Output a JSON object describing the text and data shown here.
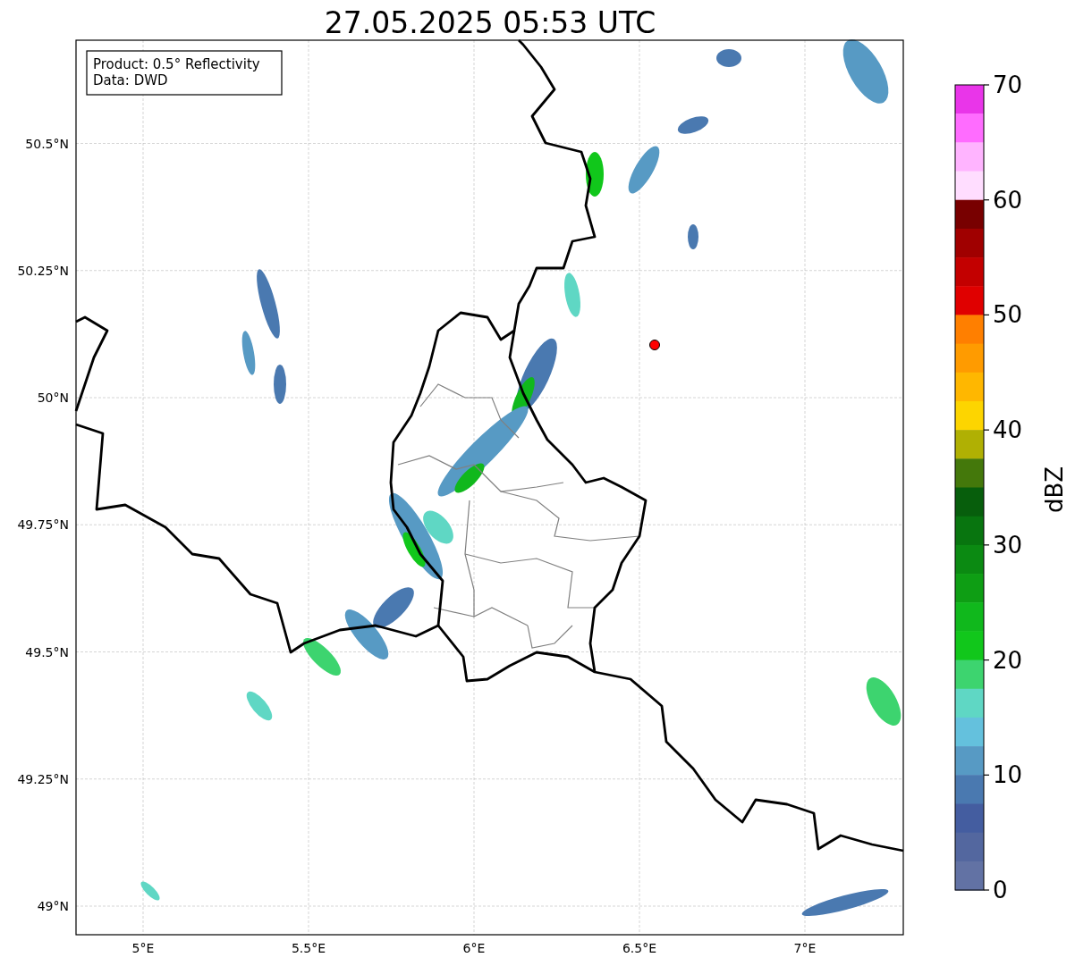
{
  "title": "27.05.2025 05:53 UTC",
  "info_box": [
    "Product: 0.5° Reflectivity",
    "Data: DWD"
  ],
  "map": {
    "lat_labels": [
      "50.5°N",
      "50.25°N",
      "50°N",
      "49.75°N",
      "49.5°N",
      "49.25°N",
      "49°N"
    ],
    "lon_labels": [
      "5°E",
      "5.5°E",
      "6°E",
      "6.5°E",
      "7°E"
    ]
  },
  "colorbar": {
    "label": "dBZ",
    "ticks": [
      "70",
      "60",
      "50",
      "40",
      "30",
      "20",
      "10",
      "0"
    ],
    "bins": [
      {
        "color": "#e935e9"
      },
      {
        "color": "#ff6cff"
      },
      {
        "color": "#ffb4ff"
      },
      {
        "color": "#ffddff"
      },
      {
        "color": "#780000"
      },
      {
        "color": "#a00000"
      },
      {
        "color": "#c30000"
      },
      {
        "color": "#e00000"
      },
      {
        "color": "#ff7f00"
      },
      {
        "color": "#ff9b00"
      },
      {
        "color": "#ffb700"
      },
      {
        "color": "#fdd500"
      },
      {
        "color": "#b0b003"
      },
      {
        "color": "#44780b"
      },
      {
        "color": "#075e0c"
      },
      {
        "color": "#08750f"
      },
      {
        "color": "#0b8a12"
      },
      {
        "color": "#0e9e14"
      },
      {
        "color": "#10b81c"
      },
      {
        "color": "#11c71b"
      },
      {
        "color": "#3dd46f"
      },
      {
        "color": "#5fd7c4"
      },
      {
        "color": "#64c1dd"
      },
      {
        "color": "#579ac4"
      },
      {
        "color": "#4a79b0"
      },
      {
        "color": "#445da0"
      },
      {
        "color": "#53679f"
      },
      {
        "color": "#6272a4"
      }
    ]
  }
}
